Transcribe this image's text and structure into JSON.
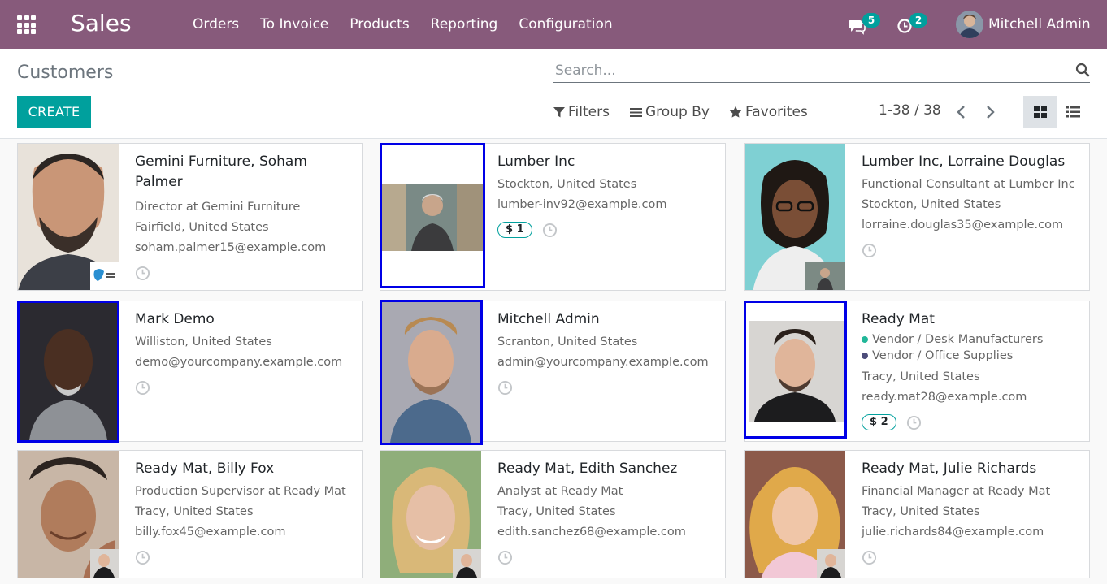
{
  "navbar": {
    "app_name": "Sales",
    "menu": [
      "Orders",
      "To Invoice",
      "Products",
      "Reporting",
      "Configuration"
    ],
    "messages_count": "5",
    "activities_count": "2",
    "user_name": "Mitchell Admin",
    "bg_color": "#875a7b"
  },
  "control": {
    "breadcrumb": "Customers",
    "search_placeholder": "Search...",
    "create_label": "CREATE",
    "filters_label": "Filters",
    "groupby_label": "Group By",
    "favorites_label": "Favorites",
    "pager": "1-38 / 38"
  },
  "cards": [
    {
      "name": "Gemini Furniture, Soham Palmer",
      "lines": [
        "Director at Gemini Furniture",
        "Fairfield, United States",
        "soham.palmer15@example.com"
      ],
      "sales": "",
      "tags": []
    },
    {
      "name": "Lumber Inc",
      "lines": [
        "Stockton, United States",
        "lumber-inv92@example.com"
      ],
      "sales": "$ 1",
      "tags": []
    },
    {
      "name": "Lumber Inc, Lorraine Douglas",
      "lines": [
        "Functional Consultant at Lumber Inc",
        "Stockton, United States",
        "lorraine.douglas35@example.com"
      ],
      "sales": "",
      "tags": []
    },
    {
      "name": "Mark Demo",
      "lines": [
        "Williston, United States",
        "demo@yourcompany.example.com"
      ],
      "sales": "",
      "tags": []
    },
    {
      "name": "Mitchell Admin",
      "lines": [
        "Scranton, United States",
        "admin@yourcompany.example.com"
      ],
      "sales": "",
      "tags": []
    },
    {
      "name": "Ready Mat",
      "lines": [
        "Tracy, United States",
        "ready.mat28@example.com"
      ],
      "sales": "$ 2",
      "tags": [
        {
          "label": "Vendor / Desk Manufacturers",
          "color": "#21b799"
        },
        {
          "label": "Vendor / Office Supplies",
          "color": "#4c4c7a"
        }
      ]
    },
    {
      "name": "Ready Mat, Billy Fox",
      "lines": [
        "Production Supervisor at Ready Mat",
        "Tracy, United States",
        "billy.fox45@example.com"
      ],
      "sales": "",
      "tags": []
    },
    {
      "name": "Ready Mat, Edith Sanchez",
      "lines": [
        "Analyst at Ready Mat",
        "Tracy, United States",
        "edith.sanchez68@example.com"
      ],
      "sales": "",
      "tags": []
    },
    {
      "name": "Ready Mat, Julie Richards",
      "lines": [
        "Financial Manager at Ready Mat",
        "Tracy, United States",
        "julie.richards84@example.com"
      ],
      "sales": "",
      "tags": []
    }
  ]
}
